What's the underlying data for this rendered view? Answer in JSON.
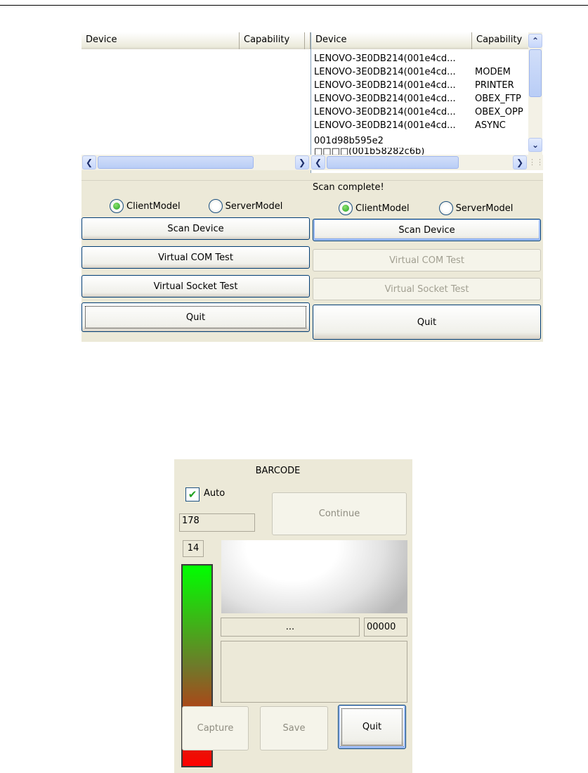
{
  "left_panel": {
    "columns": [
      "Device",
      "Capability"
    ],
    "status": "",
    "radio_client": "ClientModel",
    "radio_server": "ServerModel",
    "buttons": {
      "scan": "Scan Device",
      "vcom": "Virtual COM Test",
      "vsocket": "Virtual Socket Test",
      "quit": "Quit"
    }
  },
  "right_panel": {
    "columns": [
      "Device",
      "Capability"
    ],
    "rows": [
      {
        "device": "LENOVO-3E0DB214(001e4cd...",
        "capability": ""
      },
      {
        "device": "LENOVO-3E0DB214(001e4cd...",
        "capability": "MODEM"
      },
      {
        "device": "LENOVO-3E0DB214(001e4cd...",
        "capability": "PRINTER"
      },
      {
        "device": "LENOVO-3E0DB214(001e4cd...",
        "capability": "OBEX_FTP"
      },
      {
        "device": "LENOVO-3E0DB214(001e4cd...",
        "capability": "OBEX_OPP"
      },
      {
        "device": "LENOVO-3E0DB214(001e4cd...",
        "capability": "ASYNC"
      },
      {
        "device": "001d98b595e2",
        "capability": ""
      },
      {
        "device": "□□□□(001b58282c6b)",
        "capability": ""
      }
    ],
    "status": "Scan complete!",
    "radio_client": "ClientModel",
    "radio_server": "ServerModel",
    "buttons": {
      "scan": "Scan Device",
      "vcom": "Virtual COM Test",
      "vsocket": "Virtual Socket Test",
      "quit": "Quit"
    }
  },
  "barcode": {
    "title": "BARCODE",
    "auto_label": "Auto",
    "auto_checked": true,
    "continue": "Continue",
    "value": "178",
    "level": "14",
    "result_text": "...",
    "count": "00000",
    "capture": "Capture",
    "save": "Save",
    "quit": "Quit"
  }
}
